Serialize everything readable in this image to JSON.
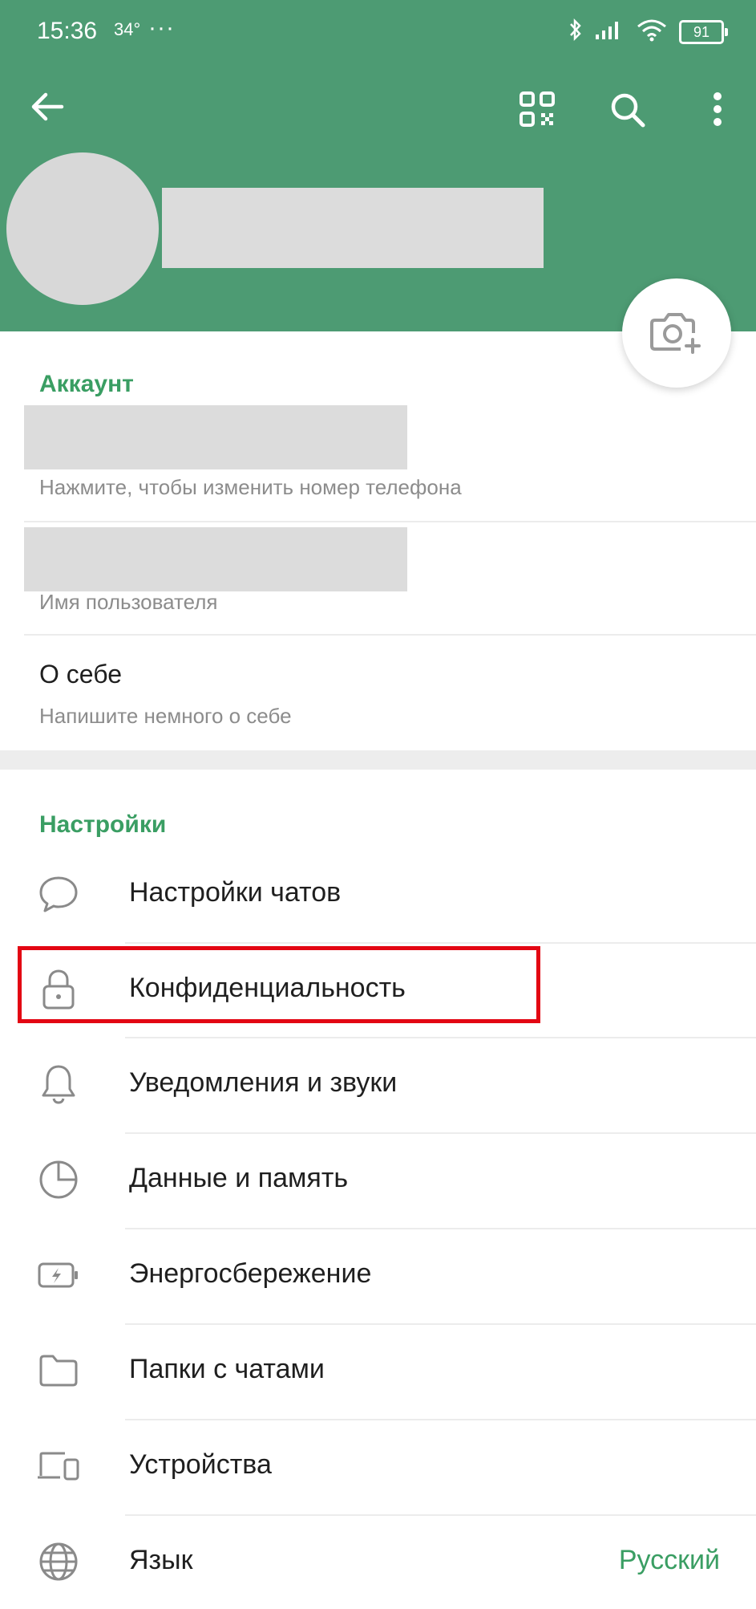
{
  "status_bar": {
    "time": "15:36",
    "temperature": "34°",
    "more": "···",
    "battery": "91"
  },
  "header": {
    "back_icon": "arrow-left-icon",
    "qr_icon": "qr-code-icon",
    "search_icon": "search-icon",
    "menu_icon": "more-vertical-icon",
    "camera_icon": "camera-add-icon",
    "color": "#4d9b73"
  },
  "account": {
    "title": "Аккаунт",
    "phone_hint": "Нажмите, чтобы изменить номер телефона",
    "username_hint": "Имя пользователя",
    "about_label": "О себе",
    "about_hint": "Напишите немного о себе"
  },
  "settings": {
    "title": "Настройки",
    "items": [
      {
        "label": "Настройки чатов",
        "icon": "chat-bubble-icon"
      },
      {
        "label": "Конфиденциальность",
        "icon": "lock-icon"
      },
      {
        "label": "Уведомления и звуки",
        "icon": "bell-icon"
      },
      {
        "label": "Данные и память",
        "icon": "pie-chart-icon"
      },
      {
        "label": "Энергосбережение",
        "icon": "battery-bolt-icon"
      },
      {
        "label": "Папки с чатами",
        "icon": "folder-icon"
      },
      {
        "label": "Устройства",
        "icon": "devices-icon"
      },
      {
        "label": "Язык",
        "icon": "globe-icon",
        "value": "Русский"
      }
    ]
  },
  "colors": {
    "accent": "#3a9e63",
    "highlight": "#e30613"
  }
}
